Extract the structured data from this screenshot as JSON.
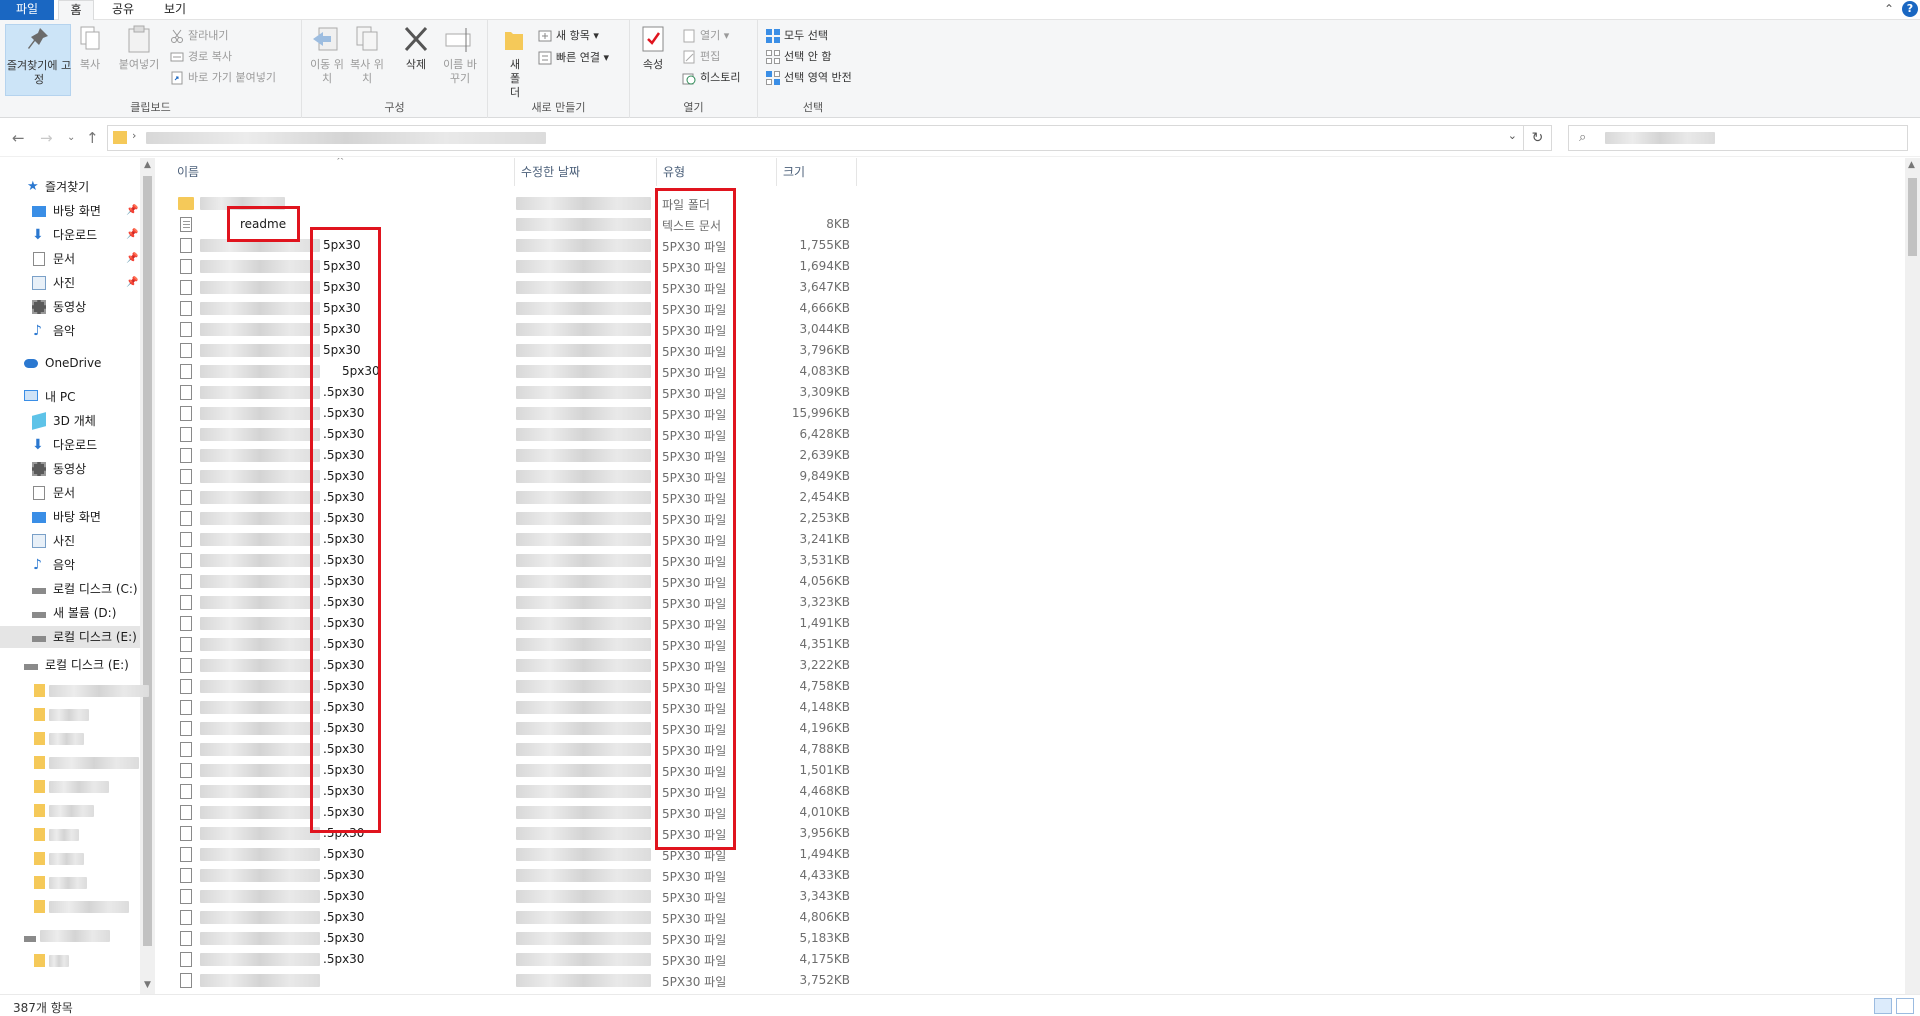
{
  "ribbon_tabs": [
    "파일",
    "홈",
    "공유",
    "보기"
  ],
  "ribbon": {
    "clipboard": {
      "pin_label": "즐겨찾기에 고정",
      "copy_label": "복사",
      "paste_label": "붙여넣기",
      "cut_label": "잘라내기",
      "copy_path_label": "경로 복사",
      "paste_shortcut_label": "바로 가기 붙여넣기",
      "group_label": "클립보드"
    },
    "organize": {
      "move_label": "이동 위치",
      "copy_to_label": "복사 위치",
      "delete_label": "삭제",
      "rename_label": "이름 바꾸기",
      "group_label": "구성"
    },
    "new": {
      "new_folder_label": "새 폴더",
      "new_item_label": "새 항목",
      "easy_access_label": "빠른 연결",
      "group_label": "새로 만들기"
    },
    "open": {
      "properties_label": "속성",
      "open_label": "열기",
      "edit_label": "편집",
      "history_label": "히스토리",
      "group_label": "열기"
    },
    "select": {
      "select_all_label": "모두 선택",
      "select_none_label": "선택 안 함",
      "invert_label": "선택 영역 반전",
      "group_label": "선택"
    }
  },
  "sidebar": {
    "quick_access": "즐겨찾기",
    "quick_items": [
      "바탕 화면",
      "다운로드",
      "문서",
      "사진",
      "동영상",
      "음악"
    ],
    "onedrive": "OneDrive",
    "this_pc": "내 PC",
    "pc_items": [
      "3D 개체",
      "다운로드",
      "동영상",
      "문서",
      "바탕 화면",
      "사진",
      "음악",
      "로컬 디스크 (C:)",
      "새 볼륨 (D:)",
      "로컬 디스크 (E:)"
    ],
    "drive_e": "로컬 디스크 (E:)"
  },
  "columns": {
    "name": "이름",
    "date": "수정한 날짜",
    "type": "유형",
    "size": "크기"
  },
  "files": [
    {
      "name": "",
      "ext": "",
      "type": "파일 폴더",
      "size": "",
      "icon": "folder"
    },
    {
      "name": "readme",
      "ext": "",
      "type": "텍스트 문서",
      "size": "8KB",
      "icon": "txt"
    },
    {
      "name": "",
      "ext": "5px30",
      "type": "5PX30 파일",
      "size": "1,755KB",
      "icon": "file"
    },
    {
      "name": "",
      "ext": "5px30",
      "type": "5PX30 파일",
      "size": "1,694KB",
      "icon": "file"
    },
    {
      "name": "",
      "ext": "5px30",
      "type": "5PX30 파일",
      "size": "3,647KB",
      "icon": "file"
    },
    {
      "name": "",
      "ext": "5px30",
      "type": "5PX30 파일",
      "size": "4,666KB",
      "icon": "file"
    },
    {
      "name": "",
      "ext": "5px30",
      "type": "5PX30 파일",
      "size": "3,044KB",
      "icon": "file"
    },
    {
      "name": "",
      "ext": "5px30",
      "type": "5PX30 파일",
      "size": "3,796KB",
      "icon": "file"
    },
    {
      "name": "",
      "ext": "5px30",
      "type": "5PX30 파일",
      "size": "4,083KB",
      "icon": "file"
    },
    {
      "name": "",
      "ext": ".5px30",
      "type": "5PX30 파일",
      "size": "3,309KB",
      "icon": "file"
    },
    {
      "name": "",
      "ext": ".5px30",
      "type": "5PX30 파일",
      "size": "15,996KB",
      "icon": "file"
    },
    {
      "name": "",
      "ext": ".5px30",
      "type": "5PX30 파일",
      "size": "6,428KB",
      "icon": "file"
    },
    {
      "name": "",
      "ext": ".5px30",
      "type": "5PX30 파일",
      "size": "2,639KB",
      "icon": "file"
    },
    {
      "name": "",
      "ext": ".5px30",
      "type": "5PX30 파일",
      "size": "9,849KB",
      "icon": "file"
    },
    {
      "name": "",
      "ext": ".5px30",
      "type": "5PX30 파일",
      "size": "2,454KB",
      "icon": "file"
    },
    {
      "name": "",
      "ext": ".5px30",
      "type": "5PX30 파일",
      "size": "2,253KB",
      "icon": "file"
    },
    {
      "name": "",
      "ext": ".5px30",
      "type": "5PX30 파일",
      "size": "3,241KB",
      "icon": "file"
    },
    {
      "name": "",
      "ext": ".5px30",
      "type": "5PX30 파일",
      "size": "3,531KB",
      "icon": "file"
    },
    {
      "name": "",
      "ext": ".5px30",
      "type": "5PX30 파일",
      "size": "4,056KB",
      "icon": "file"
    },
    {
      "name": "",
      "ext": ".5px30",
      "type": "5PX30 파일",
      "size": "3,323KB",
      "icon": "file"
    },
    {
      "name": "",
      "ext": ".5px30",
      "type": "5PX30 파일",
      "size": "1,491KB",
      "icon": "file"
    },
    {
      "name": "",
      "ext": ".5px30",
      "type": "5PX30 파일",
      "size": "4,351KB",
      "icon": "file"
    },
    {
      "name": "",
      "ext": ".5px30",
      "type": "5PX30 파일",
      "size": "3,222KB",
      "icon": "file"
    },
    {
      "name": "",
      "ext": ".5px30",
      "type": "5PX30 파일",
      "size": "4,758KB",
      "icon": "file"
    },
    {
      "name": "",
      "ext": ".5px30",
      "type": "5PX30 파일",
      "size": "4,148KB",
      "icon": "file"
    },
    {
      "name": "",
      "ext": ".5px30",
      "type": "5PX30 파일",
      "size": "4,196KB",
      "icon": "file"
    },
    {
      "name": "",
      "ext": ".5px30",
      "type": "5PX30 파일",
      "size": "4,788KB",
      "icon": "file"
    },
    {
      "name": "",
      "ext": ".5px30",
      "type": "5PX30 파일",
      "size": "1,501KB",
      "icon": "file"
    },
    {
      "name": "",
      "ext": ".5px30",
      "type": "5PX30 파일",
      "size": "4,468KB",
      "icon": "file"
    },
    {
      "name": "",
      "ext": ".5px30",
      "type": "5PX30 파일",
      "size": "4,010KB",
      "icon": "file"
    },
    {
      "name": "",
      "ext": ".5px30",
      "type": "5PX30 파일",
      "size": "3,956KB",
      "icon": "file"
    },
    {
      "name": "",
      "ext": ".5px30",
      "type": "5PX30 파일",
      "size": "1,494KB",
      "icon": "file"
    },
    {
      "name": "",
      "ext": ".5px30",
      "type": "5PX30 파일",
      "size": "4,433KB",
      "icon": "file"
    },
    {
      "name": "",
      "ext": ".5px30",
      "type": "5PX30 파일",
      "size": "3,343KB",
      "icon": "file"
    },
    {
      "name": "",
      "ext": ".5px30",
      "type": "5PX30 파일",
      "size": "4,806KB",
      "icon": "file"
    },
    {
      "name": "",
      "ext": ".5px30",
      "type": "5PX30 파일",
      "size": "5,183KB",
      "icon": "file"
    },
    {
      "name": "",
      "ext": ".5px30",
      "type": "5PX30 파일",
      "size": "4,175KB",
      "icon": "file"
    },
    {
      "name": "",
      "ext": "",
      "type": "5PX30 파일",
      "size": "3,752KB",
      "icon": "file"
    }
  ],
  "status": {
    "item_count": "387개 항목"
  },
  "colors": {
    "accent": "#1a67c2",
    "highlight_box": "#e0141e",
    "selected_bg": "#e5e5e5"
  }
}
